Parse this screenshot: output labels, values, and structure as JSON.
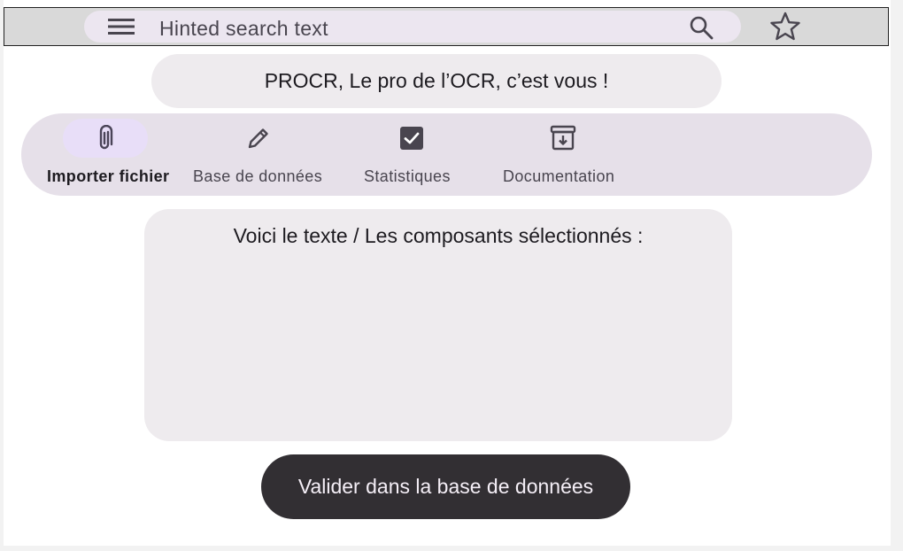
{
  "search": {
    "placeholder": "Hinted search text",
    "leading_icon": "menu-icon",
    "trailing_icon": "search-icon"
  },
  "top_actions": {
    "favorite_icon": "star-icon"
  },
  "title": "PROCR, Le pro de l’OCR, c’est vous !",
  "nav": {
    "items": [
      {
        "label": "Importer fichier",
        "icon": "paperclip-icon",
        "active": true
      },
      {
        "label": "Base de données",
        "icon": "pencil-icon",
        "active": false
      },
      {
        "label": "Statistiques",
        "icon": "checkbox-icon",
        "active": false
      },
      {
        "label": "Documentation",
        "icon": "archive-icon",
        "active": false
      }
    ]
  },
  "content": {
    "heading": "Voici le texte / Les composants sélectionnés :"
  },
  "validate_button": {
    "label": "Valider dans la base de données"
  },
  "colors": {
    "topbar": "#d9d9d9",
    "searchbar": "#ece6f0",
    "nav_background": "#e6e0e9",
    "nav_active": "#e8def8",
    "panel": "#eeebee",
    "button": "#322f33",
    "button_text": "#f5eff7"
  }
}
